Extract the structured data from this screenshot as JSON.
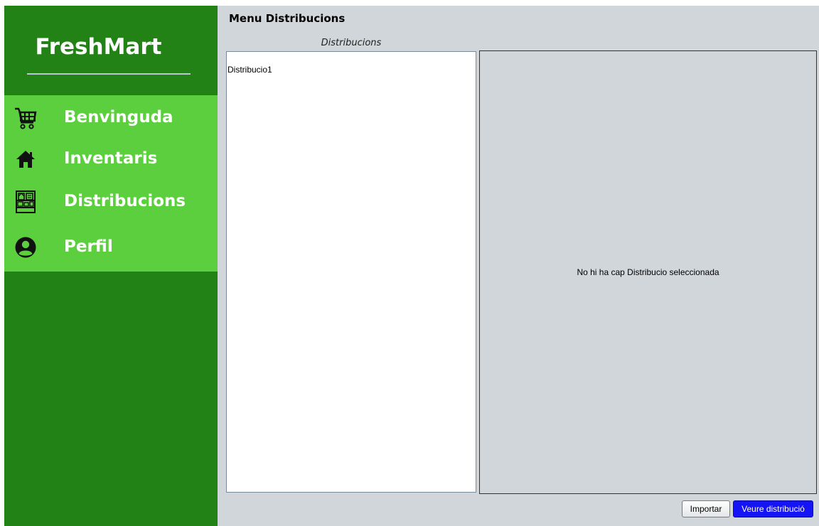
{
  "sidebar": {
    "brand": "FreshMart",
    "items": [
      {
        "label": "Benvinguda",
        "icon": "shopping-cart-icon"
      },
      {
        "label": "Inventaris",
        "icon": "home-icon"
      },
      {
        "label": "Distribucions",
        "icon": "shelf-icon"
      },
      {
        "label": "Perfil",
        "icon": "user-profile-icon"
      }
    ]
  },
  "main": {
    "title": "Menu Distribucions",
    "list_caption": "Distribucions",
    "list_items": [
      "Distribucio1"
    ],
    "empty_message": "No hi ha cap Distribucio seleccionada"
  },
  "buttons": {
    "import_label": "Importar",
    "view_label": "Veure distribució"
  },
  "colors": {
    "sidebar": "#238215",
    "nav": "#5ccf3e",
    "primary_button": "#1414f5",
    "background": "#d1d6da"
  }
}
